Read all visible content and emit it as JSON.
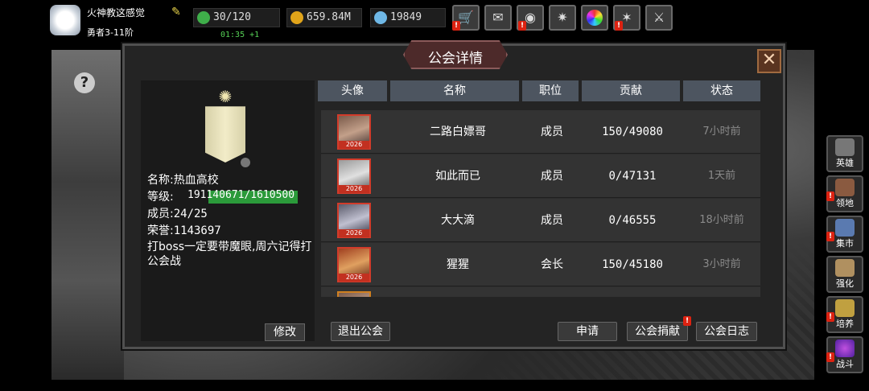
{
  "player": {
    "name": "火神教这感觉",
    "rank": "勇者3-11阶",
    "stamina": "30/120",
    "stamina_timer": "01:35 +1",
    "gold": "659.84M",
    "gems": "19849"
  },
  "top_buttons": [
    {
      "icon": "shop-cart-icon",
      "alert": "!"
    },
    {
      "icon": "mail-icon",
      "alert": ""
    },
    {
      "icon": "gamepad-icon",
      "alert": "!"
    },
    {
      "icon": "settings-icon",
      "alert": ""
    },
    {
      "icon": "color-wheel-icon",
      "alert": ""
    },
    {
      "icon": "sparkle-icon",
      "alert": "!"
    },
    {
      "icon": "crossed-swords-icon",
      "alert": ""
    }
  ],
  "side_menu": [
    {
      "label": "英雄",
      "icon": "helmet-icon",
      "alert": ""
    },
    {
      "label": "领地",
      "icon": "castle-icon",
      "alert": "!"
    },
    {
      "label": "集市",
      "icon": "market-icon",
      "alert": "!"
    },
    {
      "label": "强化",
      "icon": "crystal-icon",
      "alert": ""
    },
    {
      "label": "培养",
      "icon": "trophy-icon",
      "alert": "!"
    },
    {
      "label": "战斗",
      "icon": "portal-icon",
      "alert": "!"
    }
  ],
  "dialog": {
    "title": "公会详情",
    "guild": {
      "name_label": "名称:",
      "name": "热血高校",
      "level_label": "等级:",
      "level_value": "191140671/1610500",
      "level_progress": 0.87,
      "members_label": "成员:",
      "members": "24/25",
      "honor_label": "荣誉:",
      "honor": "1143697",
      "notice": "打boss一定要带魔眼,周六记得打公会战"
    },
    "modify_label": "修改",
    "columns": [
      "头像",
      "名称",
      "职位",
      "贡献",
      "状态"
    ],
    "members": [
      {
        "name": "二路白嫖哥",
        "role": "成员",
        "contribution": "150/49080",
        "status": "7小时前",
        "badge": "2026"
      },
      {
        "name": "如此而已",
        "role": "成员",
        "contribution": "0/47131",
        "status": "1天前",
        "badge": "2026"
      },
      {
        "name": "大大滴",
        "role": "成员",
        "contribution": "0/46555",
        "status": "18小时前",
        "badge": "2026"
      },
      {
        "name": "猩猩",
        "role": "会长",
        "contribution": "150/45180",
        "status": "3小时前",
        "badge": "2026"
      }
    ],
    "buttons": {
      "leave": "退出公会",
      "apply": "申请",
      "donate": "公会捐献",
      "log": "公会日志"
    }
  },
  "colors": {
    "xp_fill": "#2b9a3a",
    "alert": "#dd2211",
    "header": "#4d5560"
  }
}
